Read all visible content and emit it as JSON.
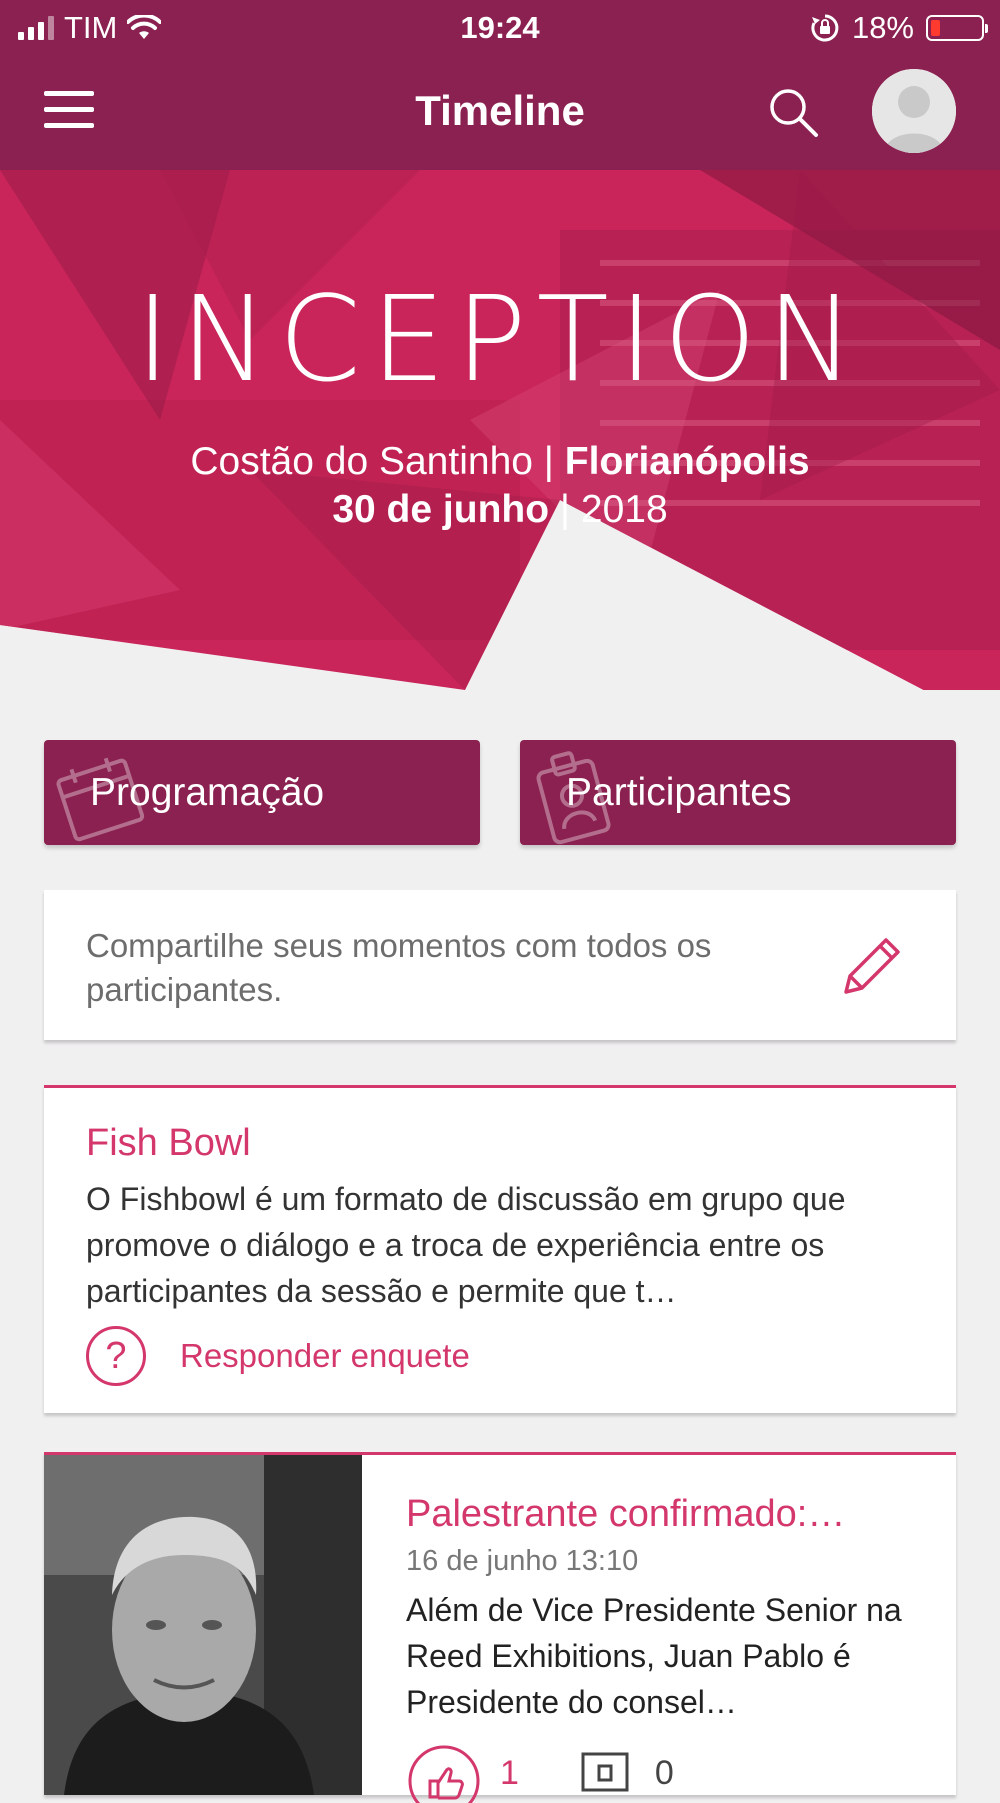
{
  "status_bar": {
    "carrier": "TIM",
    "time": "19:24",
    "battery": "18%",
    "battery_level": 0.18
  },
  "nav": {
    "title": "Timeline",
    "icons": [
      "menu-icon",
      "search-icon",
      "avatar"
    ]
  },
  "hero": {
    "logo": "INCEPTION",
    "venue": "Costão do Santinho",
    "city": "Florianópolis",
    "date": "30 de junho",
    "year": "2018",
    "separator": "|"
  },
  "buttons": {
    "schedule_label": "Programação",
    "participants_label": "Participantes"
  },
  "share": {
    "text": "Compartilhe seus momentos com todos os participantes."
  },
  "poll_card": {
    "title": "Fish Bowl",
    "body": "O Fishbowl é um formato de discussão em grupo que promove o diálogo e a troca de experiência entre os participantes da sessão e permite que t…",
    "action": "Responder enquete"
  },
  "news_card": {
    "title": "Palestrante confirmado:…",
    "date": "16 de junho 13:10",
    "body": "Além de Vice Presidente Senior na Reed Exhibitions, Juan Pablo é Presidente do consel…",
    "likes": "1",
    "comments": "0"
  },
  "colors": {
    "brand": "#8b2150",
    "accent": "#d4376b",
    "hero_overlay": "#d42a5e",
    "background": "#f1f0f1"
  }
}
